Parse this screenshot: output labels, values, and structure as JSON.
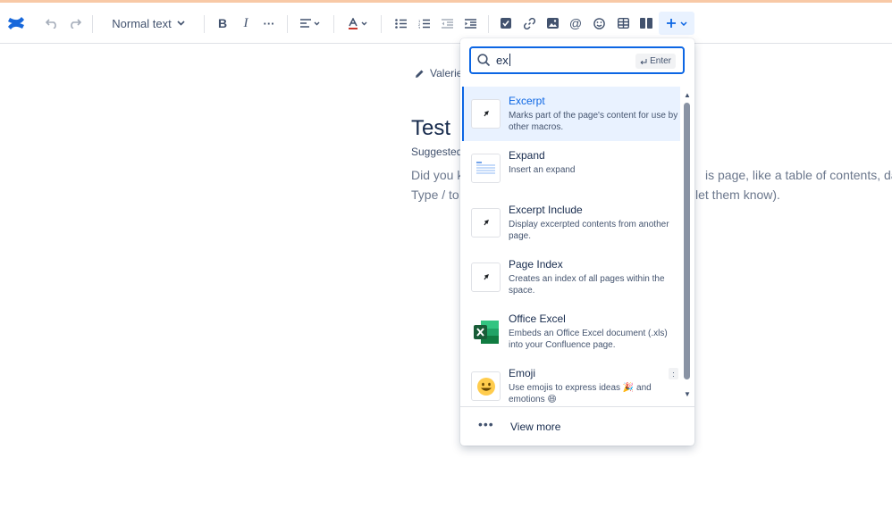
{
  "toolbar": {
    "text_style": "Normal text",
    "icons": [
      "confluence-logo-icon",
      "undo-icon",
      "redo-icon",
      "bold-icon",
      "italic-icon",
      "more-formatting-icon",
      "align-icon",
      "text-color-icon",
      "bullet-list-icon",
      "numbered-list-icon",
      "outdent-icon",
      "indent-icon",
      "task-icon",
      "link-icon",
      "image-icon",
      "mention-icon",
      "emoji-icon",
      "table-icon",
      "layout-icon",
      "insert-plus-icon"
    ],
    "accent": "#0c66e4"
  },
  "page": {
    "author": "Valerie",
    "title": "Test",
    "suggested": "Suggested",
    "line1_left": "Did you k",
    "line1_right": "is page, like a table of contents, date, o",
    "line2_left": "Type / to",
    "line2_right": "let them know)."
  },
  "insert_menu": {
    "search_value": "ex",
    "enter_label": "Enter",
    "items": [
      {
        "name": "Excerpt",
        "description": "Marks part of the page's content for use by other macros.",
        "icon": "macro-icon",
        "selected": true
      },
      {
        "name": "Expand",
        "description": "Insert an expand",
        "icon": "expand-icon"
      },
      {
        "name": "Excerpt Include",
        "description": "Display excerpted contents from another page.",
        "icon": "macro-icon"
      },
      {
        "name": "Page Index",
        "description": "Creates an index of all pages within the space.",
        "icon": "macro-icon"
      },
      {
        "name": "Office Excel",
        "description": "Embeds an Office Excel document (.xls) into your Confluence page.",
        "icon": "excel-icon"
      },
      {
        "name": "Emoji",
        "description": "Use emojis to express ideas 🎉 and emotions 😄",
        "icon": "emoji-icon",
        "shortcut": ":"
      }
    ],
    "view_more": "View more"
  }
}
